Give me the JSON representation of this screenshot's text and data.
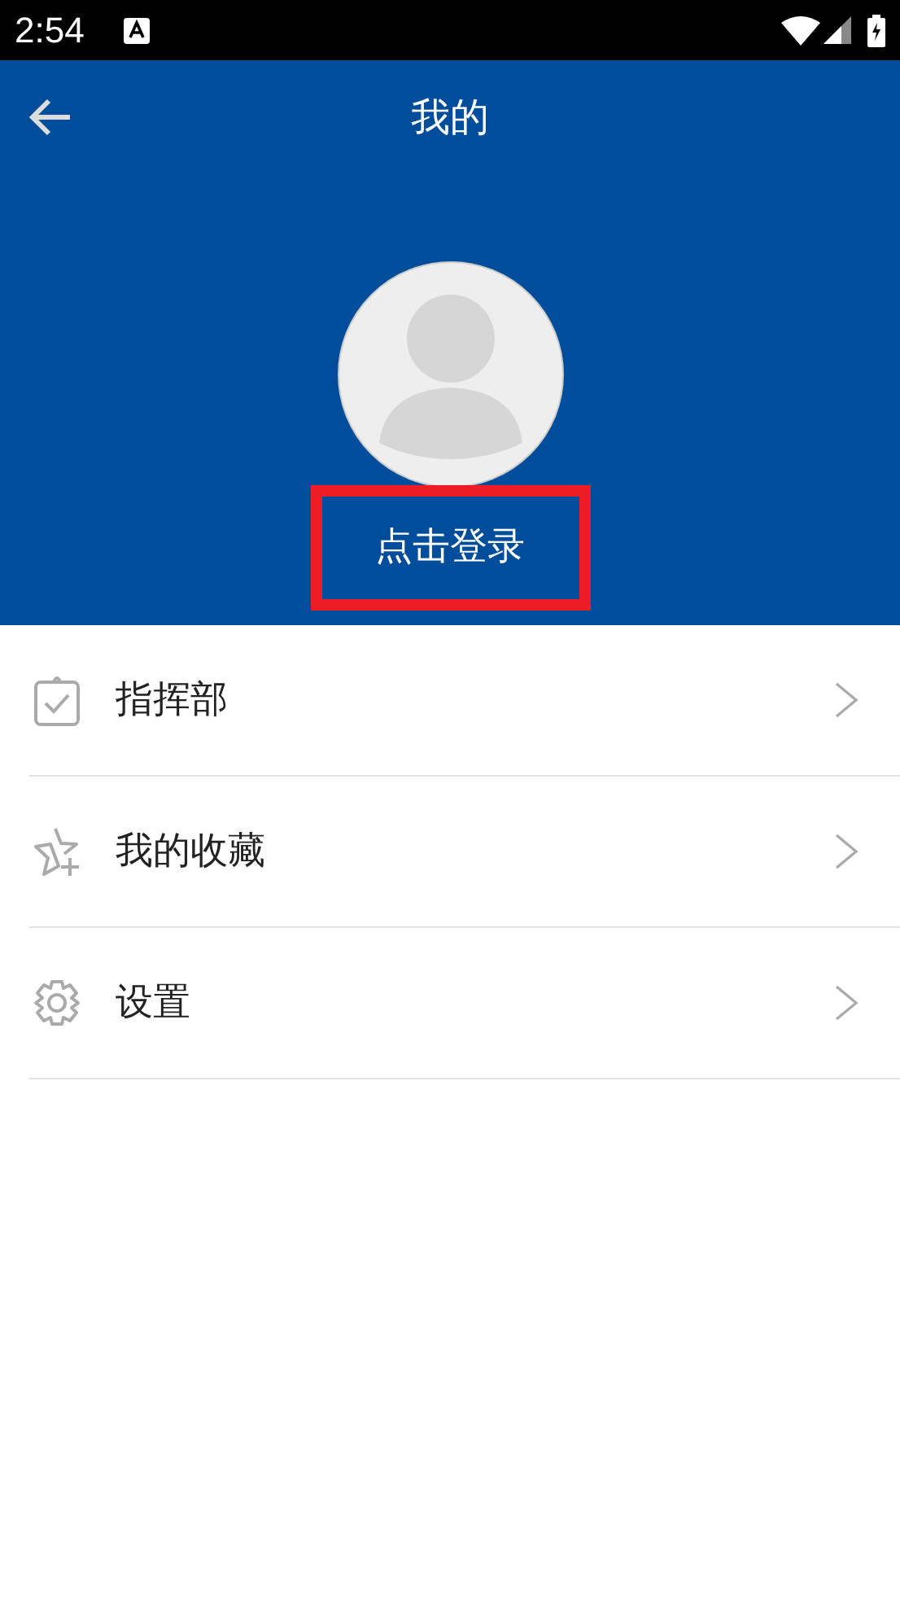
{
  "status_bar": {
    "time": "2:54"
  },
  "header": {
    "title": "我的"
  },
  "login": {
    "label": "点击登录",
    "highlighted": true
  },
  "menu": [
    {
      "kind": "clipboard",
      "label": "指挥部"
    },
    {
      "kind": "star",
      "label": "我的收藏"
    },
    {
      "kind": "gear",
      "label": "设置"
    }
  ]
}
